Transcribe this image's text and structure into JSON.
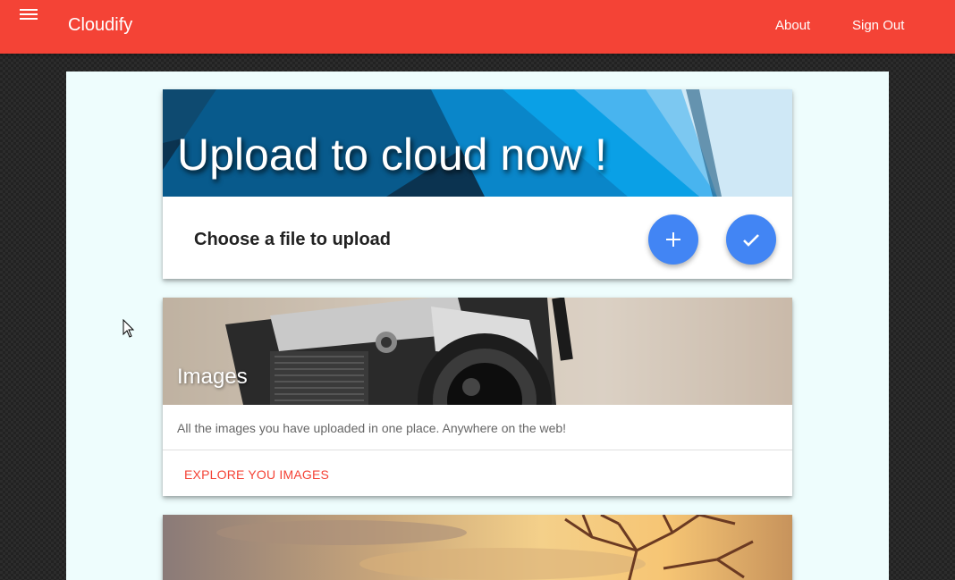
{
  "app": {
    "brand": "Cloudify",
    "colors": {
      "primary": "#f44336",
      "accent": "#4285f4",
      "content_bg": "#eefdfd"
    }
  },
  "navbar": {
    "menu_icon": "hamburger-menu-icon",
    "links": [
      {
        "label": "About"
      },
      {
        "label": "Sign Out"
      }
    ]
  },
  "upload_card": {
    "title": "Upload to cloud now !",
    "label": "Choose a file to upload",
    "add_icon": "plus-icon",
    "submit_icon": "check-icon"
  },
  "images_card": {
    "title": "Images",
    "description": "All the images you have uploaded in one place. Anywhere on the web!",
    "action": "EXPLORE YOU IMAGES"
  }
}
